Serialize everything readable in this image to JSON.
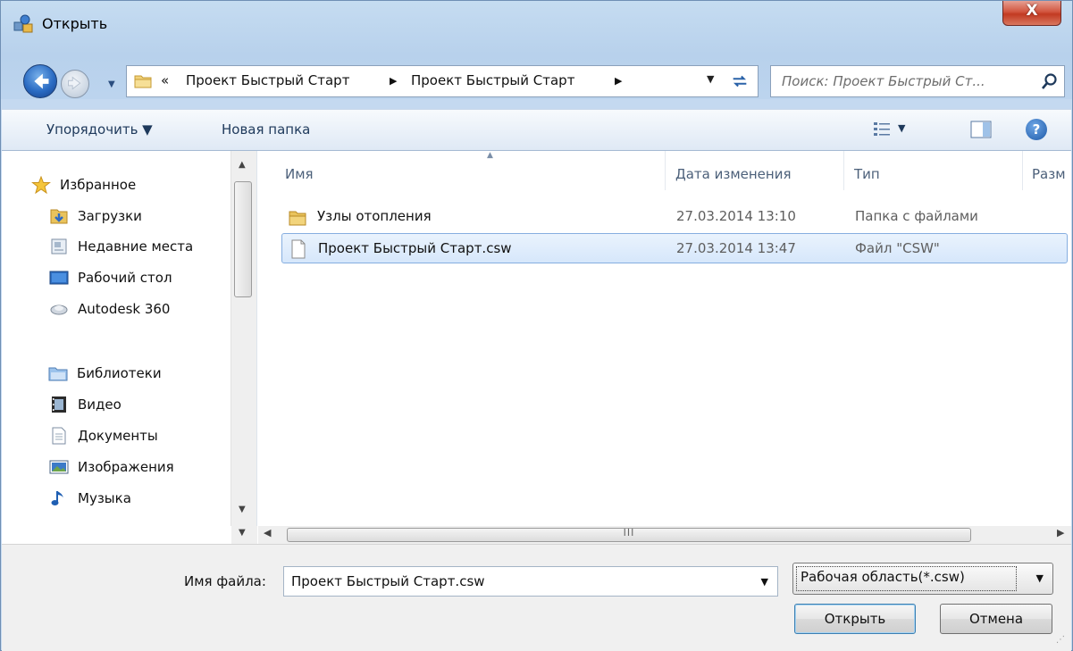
{
  "window": {
    "title": "Открыть",
    "close_label": "X"
  },
  "navigation": {
    "history_arrow": "▼",
    "address": {
      "overflow": "«",
      "crumbs": [
        "Проект Быстрый Старт",
        "Проект Быстрый Старт"
      ],
      "separator": "▶",
      "dropdown": "▼"
    },
    "refresh_label": "↔",
    "search_placeholder": "Поиск: Проект Быстрый Ст..."
  },
  "toolbar": {
    "organize_label": "Упорядочить ▼",
    "new_folder_label": "Новая папка",
    "view_arrow": "▼",
    "help_label": "?"
  },
  "sidebar": {
    "favorites": {
      "label": "Избранное",
      "items": [
        {
          "label": "Загрузки",
          "icon": "downloads-folder-icon"
        },
        {
          "label": "Недавние места",
          "icon": "recent-places-icon"
        },
        {
          "label": "Рабочий стол",
          "icon": "desktop-icon"
        },
        {
          "label": "Autodesk 360",
          "icon": "cloud-icon"
        }
      ]
    },
    "libraries": {
      "label": "Библиотеки",
      "items": [
        {
          "label": "Видео",
          "icon": "video-icon"
        },
        {
          "label": "Документы",
          "icon": "documents-icon"
        },
        {
          "label": "Изображения",
          "icon": "images-icon"
        },
        {
          "label": "Музыка",
          "icon": "music-icon"
        }
      ]
    }
  },
  "filelist": {
    "columns": [
      "Имя",
      "Дата изменения",
      "Тип",
      "Разм"
    ],
    "rows": [
      {
        "name": "Узлы отопления",
        "date": "27.03.2014 13:10",
        "type": "Папка с файлами",
        "icon": "folder-icon",
        "selected": false
      },
      {
        "name": "Проект Быстрый Старт.csw",
        "date": "27.03.2014 13:47",
        "type": "Файл \"CSW\"",
        "icon": "file-icon",
        "selected": true
      }
    ],
    "hscroll_grip": "III"
  },
  "bottom": {
    "filename_label": "Имя файла:",
    "filename_value": "Проект Быстрый Старт.csw",
    "filetype_value": "Рабочая область(*.csw)",
    "open_label": "Открыть",
    "cancel_label": "Отмена"
  },
  "colors": {
    "accent": "#2a6bc3",
    "selection": "#d6e7fb",
    "close_red": "#c23a22"
  }
}
